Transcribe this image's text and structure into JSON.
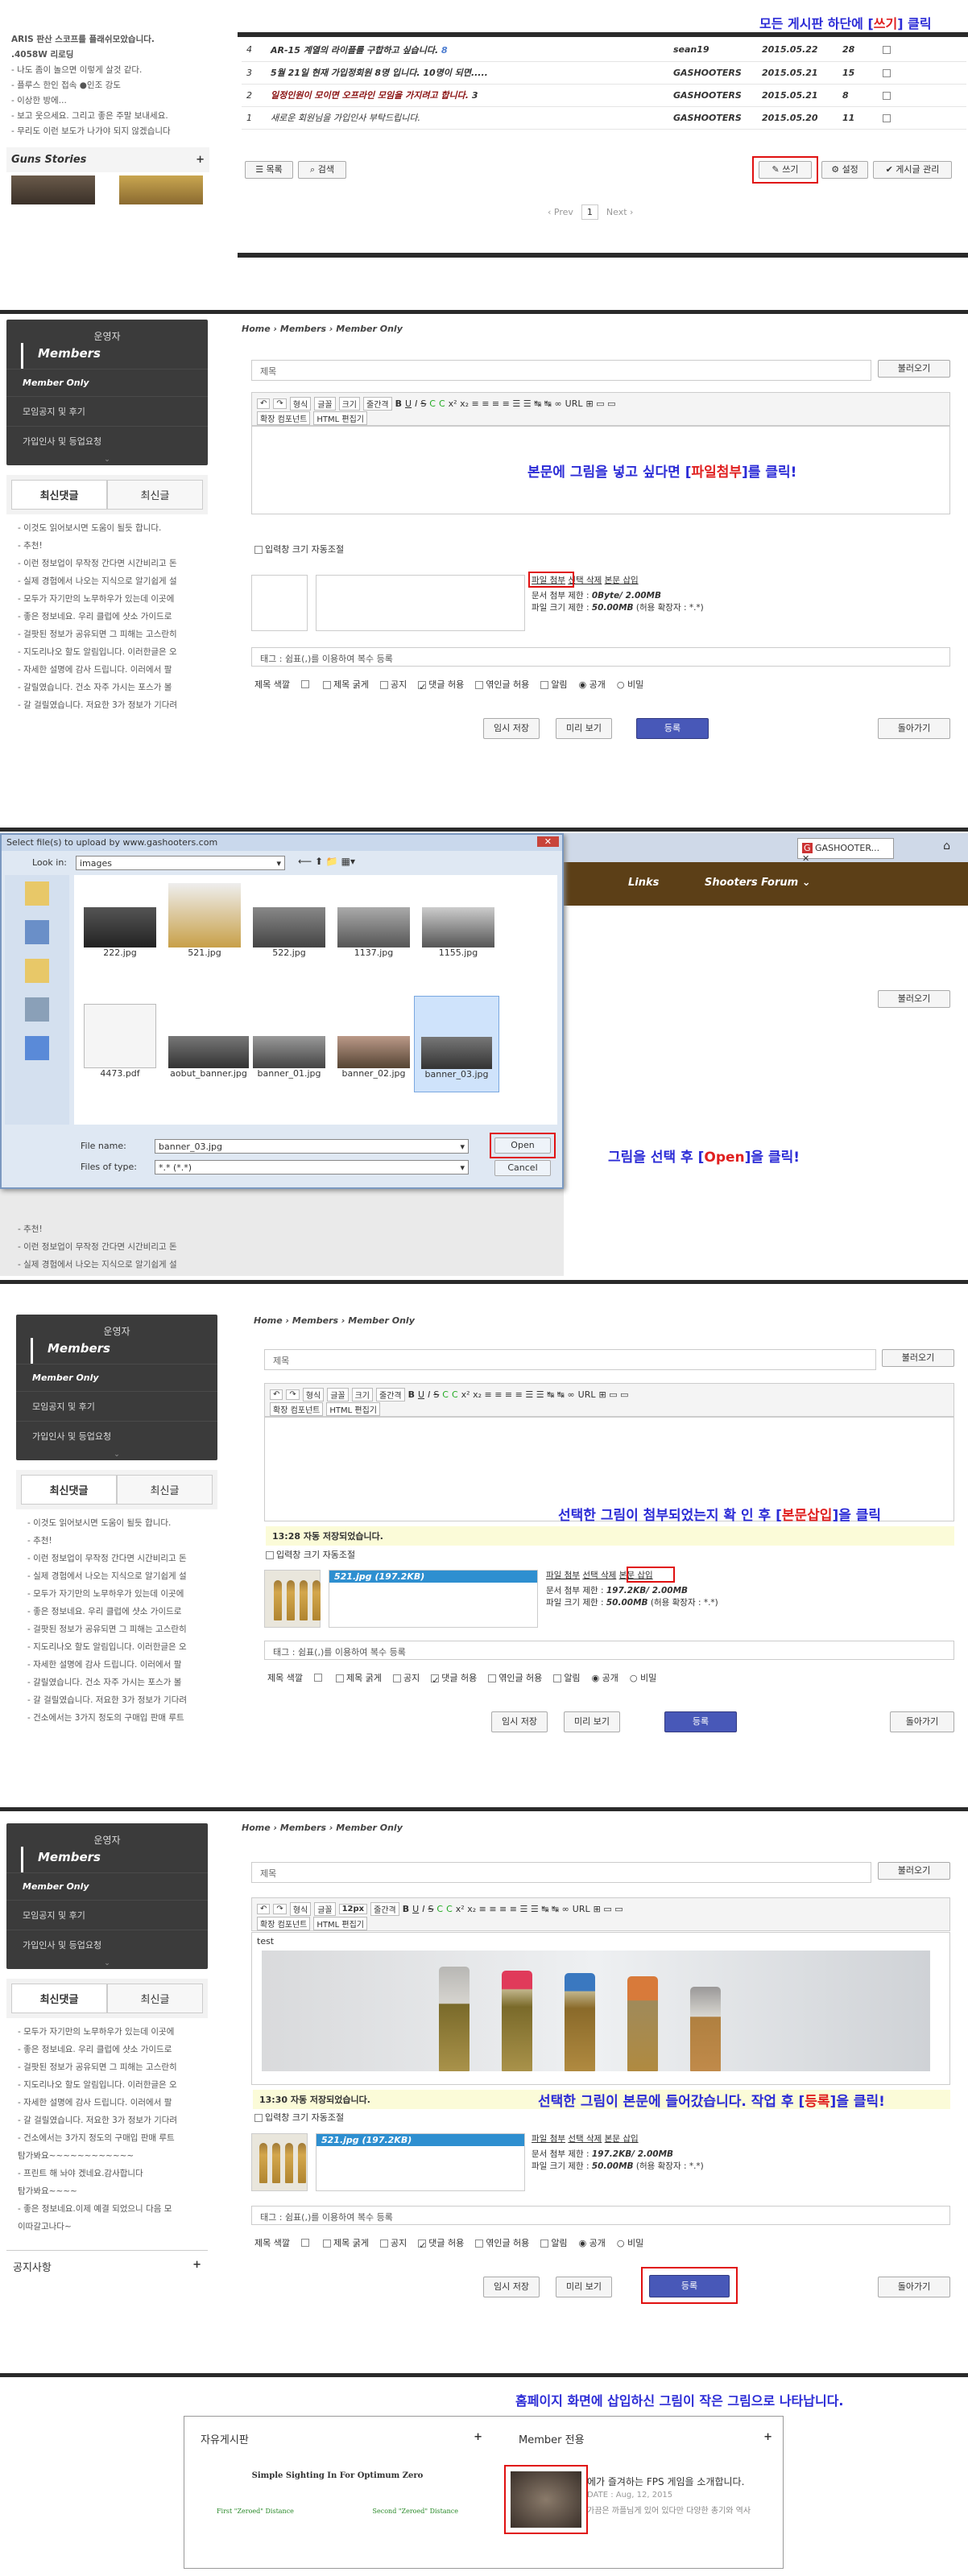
{
  "panel1": {
    "annotation_pre": "모든 게시판 하단에 [",
    "annotation_red": "쓰기",
    "annotation_post": "] 클릭",
    "sidebar_links": [
      "ARIS 판산 스코프를 플래쉬모았습니다.",
      ".4058W 리로딩",
      "- 나도 좀이 놀으면 이렇게 살것 같다.",
      "- 플루스 한인 접속 ●인조 강도",
      "- 이상한 방에...",
      "- 보고 웃으세요. 그리고 좋은 주말 보내세요.",
      "- 무리도 이런 보도가 나가야 되지 않겠습니다"
    ],
    "guns_stories": "Guns Stories",
    "rows": [
      {
        "num": "4",
        "title": "AR-15 계열의 라이플를 구합하고 싶습니다.",
        "tag": "8",
        "author": "sean19",
        "date": "2015.05.22",
        "views": "28"
      },
      {
        "num": "3",
        "title": "5월 21일 현재 가입정회원 8명 입니다. 10명이 되면.....",
        "tag": "",
        "author": "GASHOOTERS",
        "date": "2015.05.21",
        "views": "15"
      },
      {
        "num": "2",
        "title": "일정인원이 모이면 오프라인 모임을 가지려고 합니다.",
        "tag": "3",
        "author": "GASHOOTERS",
        "date": "2015.05.21",
        "views": "8"
      },
      {
        "num": "1",
        "title": "새로운 회원님을 가입인사 부탁드립니다.",
        "tag": "",
        "author": "GASHOOTERS",
        "date": "2015.05.20",
        "views": "11"
      }
    ],
    "btn_list": "목록",
    "btn_search": "검색",
    "btn_write": "쓰기",
    "btn_settings": "설정",
    "btn_admin": "게시글 관리",
    "pager_prev": "‹ Prev",
    "pager_current": "1",
    "pager_next": "Next ›"
  },
  "sidebar": {
    "operator": "운영자",
    "members": "Members",
    "items": [
      "Member Only",
      "모임공지 및 후기",
      "가입인사 및 등업요청"
    ],
    "tab_recent_comments": "최신댓글",
    "tab_recent_posts": "최신글",
    "comments": [
      "- 이것도 읽어보시면 도움이 될듯 합니다.",
      "- 추천!",
      "- 이런 정보업이 무작정 간다면 시간비리고 돈",
      "- 실제 경험에서 나오는 지식으로 알기쉽게 설",
      "- 모두가 자기만의 노무하우가 있는데 이곳에",
      "- 좋은 정보네요. 우리 클럽에 샷소 가이드로",
      "- 걸팟된 정보가 공유되면 그 피해는 고스란히",
      "- 지도리나오 할도 알림입니다. 이러한글은 오",
      "- 자세한 설명에 감사 드립니다. 이러에서 팔",
      "- 갈릴였습니다. 건소 자주 가시는 포스가 볼",
      "- 갈 걸릴였습니다. 저요한 3가 정보가 기다려",
      "- 건소에서는 3가지 정도의 구매입 판매 루트"
    ],
    "comments_p5": [
      "- 모두가 자기만의 노무하우가 있는데 이곳에",
      "- 좋은 정보네요. 우리 클럽에 샷소 가이드로",
      "- 걸팟된 정보가 공유되면 그 피해는 고스란히",
      "- 지도리나오 할도 알림입니다. 이러한글은 오",
      "- 자세한 설명에 감사 드립니다. 이러에서 팔",
      "- 갈 걸릴였습니다. 저요한 3가 정보가 기다려",
      "- 건소에서는 3가지 정도의 구매입 판매 루트",
      "  탐가봐요~~~~~~~~~~~~",
      "- 프린트 해 놔야 겠네요.감사합니다",
      "  탐가봐요~~~~",
      "- 좋은 정보네요.이제 예결 되었으니 다음 모",
      "  이따갈고나다~"
    ],
    "notice": "공지사항"
  },
  "crumb": {
    "home": "Home",
    "members": "Members",
    "member_only": "Member Only"
  },
  "editor": {
    "title_placeholder": "제목",
    "load_button": "불러오기",
    "style": "형식",
    "font": "글꼴",
    "size": "크기",
    "size_12": "12px",
    "line_height": "줄간격",
    "url": "URL",
    "ext_component": "확장 컴포넌트",
    "html_edit": "HTML 편집기",
    "auto_resize": "입력창 크기 자동조절",
    "file_attach": "파일 첨부",
    "select_delete": "선택 삭제",
    "insert_body": "본문 삽입",
    "doc_limit": "문서 첨부 제한 :",
    "doc_limit_val_0": "0Byte/ 2.00MB",
    "doc_limit_val_1": "197.2KB/ 2.00MB",
    "file_limit": "파일 크기 제한 :",
    "file_limit_val": "50.00MB",
    "file_limit_ext": "(허용 확장자 : *.*)",
    "tag_hint": "태그 : 쉼표(,)를 이용하여 복수 등록",
    "editor_color": "제목 색깔",
    "opt_bold": "제목 굵게",
    "opt_notice": "공지",
    "opt_comment": "댓글 허용",
    "opt_trackback": "엮인글 허용",
    "opt_alert": "알림",
    "opt_public": "공개",
    "opt_secret": "비밀",
    "btn_temp_save": "임시 저장",
    "btn_preview": "미리 보기",
    "btn_submit": "등록",
    "btn_back": "돌아가기",
    "autosave_1": "13:28 자동 저장되었습니다.",
    "autosave_2": "13:30 자동 저장되었습니다.",
    "attached_file": "521.jpg (197.2KB)",
    "body_text": "test"
  },
  "panel2": {
    "annotation_pre": "본문에 그림을 넣고 싶다면 [",
    "annotation_red": "파일첨부",
    "annotation_post": "]를 클릭!"
  },
  "panel3": {
    "dialog_title": "Select file(s) to upload by www.gashooters.com",
    "look_in_label": "Look in:",
    "look_in_value": "images",
    "files": [
      "222.jpg",
      "521.jpg",
      "522.jpg",
      "1137.jpg",
      "1155.jpg",
      "4473.pdf",
      "aobut_banner.jpg",
      "banner_01.jpg",
      "banner_02.jpg",
      "banner_03.jpg"
    ],
    "file_name_label": "File name:",
    "file_name_value": "banner_03.jpg",
    "file_type_label": "Files of type:",
    "file_type_value": "*.* (*.*)",
    "btn_open": "Open",
    "btn_cancel": "Cancel",
    "browser_tab": "GASHOOTER...",
    "nav_links": "Links",
    "nav_forum": "Shooters Forum",
    "annotation_pre": "그림을 선택 후 [",
    "annotation_red": "Open",
    "annotation_post": "]을 클릭!",
    "left_places": [
      "Recent",
      "Desktop",
      "Libraries",
      "Computer",
      "Network"
    ]
  },
  "panel4": {
    "annotation_pre": "선택한 그림이 첨부되었는지 확 인 후 [",
    "annotation_red": "본문삽입",
    "annotation_post": "]을 클릭"
  },
  "panel5": {
    "annotation_pre": "선택한 그림이 본문에 들어갔습니다. 작업 후 [",
    "annotation_red": "등록",
    "annotation_post": "]을 클릭!"
  },
  "panel6": {
    "annotation": "홈페이지 화면에 삽입하신 그림이 작은 그림으로 나타납니다.",
    "free_board": "자유게시판",
    "member_board": "Member 전용",
    "ad_title": "Simple Sighting In For Optimum Zero",
    "ad_label_1": "First \"Zeroed\" Distance",
    "ad_label_2": "Second \"Zeroed\" Distance",
    "post_title": "에가 즐겨하는 FPS 게임을 소개합니다.",
    "post_date": "DATE : Aug, 12, 2015",
    "post_excerpt": "가끔은 까플님게 있어 있다만 다양한 총기와 역사"
  }
}
